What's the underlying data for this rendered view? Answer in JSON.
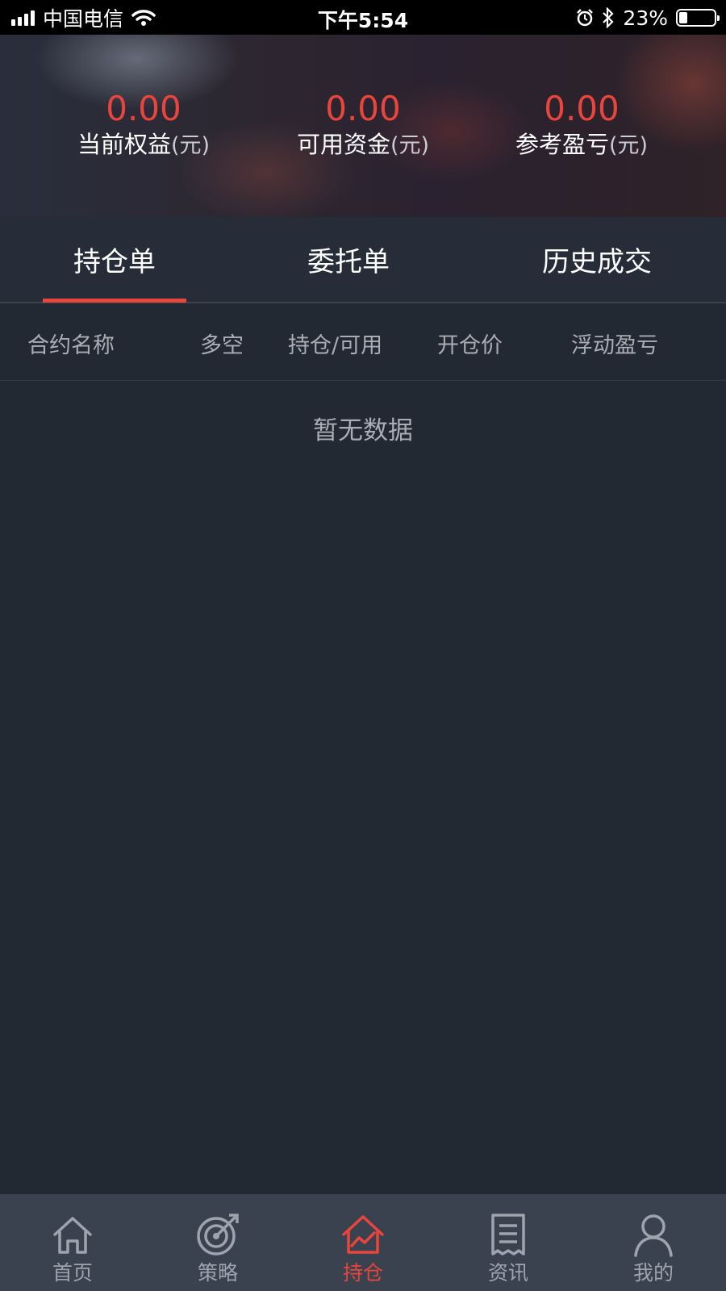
{
  "status_bar": {
    "carrier": "中国电信",
    "time": "下午5:54",
    "battery": "23%",
    "battery_level": 0.23,
    "icons": [
      "signal-icon",
      "wifi-icon",
      "alarm-icon",
      "bluetooth-icon",
      "battery-icon"
    ]
  },
  "summary": {
    "equity": {
      "value": "0.00",
      "label": "当前权益",
      "unit": "(元)"
    },
    "available": {
      "value": "0.00",
      "label": "可用资金",
      "unit": "(元)"
    },
    "pnl": {
      "value": "0.00",
      "label": "参考盈亏",
      "unit": "(元)"
    }
  },
  "tabs": [
    {
      "label": "持仓单",
      "active": true
    },
    {
      "label": "委托单",
      "active": false
    },
    {
      "label": "历史成交",
      "active": false
    }
  ],
  "table": {
    "columns": [
      "合约名称",
      "多空",
      "持仓/可用",
      "开仓价",
      "浮动盈亏"
    ],
    "rows": [],
    "empty_text": "暂无数据"
  },
  "nav": [
    {
      "label": "首页",
      "icon": "home-icon",
      "active": false
    },
    {
      "label": "策略",
      "icon": "target-icon",
      "active": false
    },
    {
      "label": "持仓",
      "icon": "position-chart-icon",
      "active": true
    },
    {
      "label": "资讯",
      "icon": "news-icon",
      "active": false
    },
    {
      "label": "我的",
      "icon": "profile-icon",
      "active": false
    }
  ],
  "colors": {
    "accent": "#e8453c",
    "background": "#232933",
    "nav_background": "#3a4250",
    "muted_text": "#a8adb6"
  }
}
